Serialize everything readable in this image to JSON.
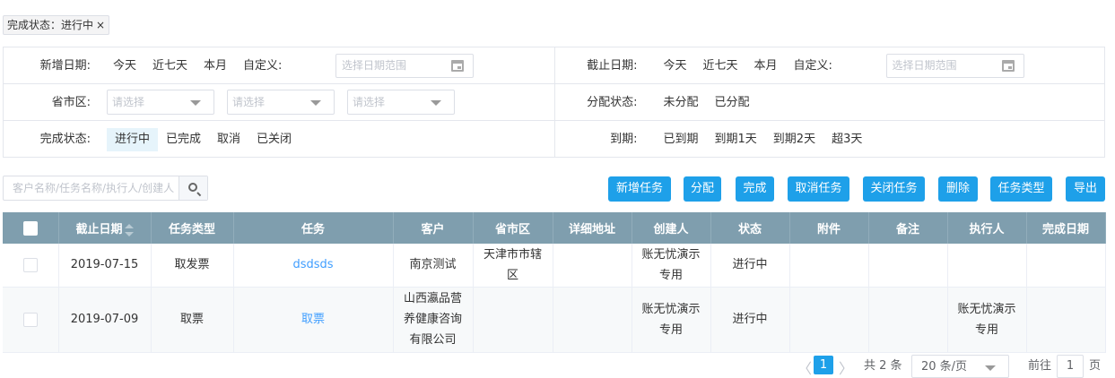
{
  "active_filter": {
    "label": "完成状态：进行中",
    "close": "×"
  },
  "filters": {
    "new_date": {
      "label": "新增日期:",
      "options": [
        "今天",
        "近七天",
        "本月",
        "自定义:"
      ],
      "placeholder": "选择日期范围"
    },
    "due_date": {
      "label": "截止日期:",
      "options": [
        "今天",
        "近七天",
        "本月",
        "自定义:"
      ],
      "placeholder": "选择日期范围"
    },
    "region": {
      "label": "省市区:",
      "selects": [
        "请选择",
        "请选择",
        "请选择"
      ]
    },
    "assign_status": {
      "label": "分配状态:",
      "options": [
        "未分配",
        "已分配"
      ]
    },
    "complete_status": {
      "label": "完成状态:",
      "options": [
        "进行中",
        "已完成",
        "取消",
        "已关闭"
      ],
      "active": "进行中"
    },
    "expire": {
      "label": "到期:",
      "options": [
        "已到期",
        "到期1天",
        "到期2天",
        "超3天"
      ]
    }
  },
  "search": {
    "placeholder": "客户名称/任务名称/执行人/创建人"
  },
  "toolbar": {
    "buttons": [
      "新增任务",
      "分配",
      "完成",
      "取消任务",
      "关闭任务",
      "删除",
      "任务类型",
      "导出"
    ]
  },
  "table": {
    "columns": [
      "截止日期",
      "任务类型",
      "任务",
      "客户",
      "省市区",
      "详细地址",
      "创建人",
      "状态",
      "附件",
      "备注",
      "执行人",
      "完成日期"
    ],
    "rows": [
      {
        "due": "2019-07-15",
        "type": "取发票",
        "task": "dsdsds",
        "customer": "南京测试",
        "region": "天津市市辖区",
        "address": "",
        "creator": "账无忧演示专用",
        "status": "进行中",
        "attachment": "",
        "note": "",
        "executor": "",
        "done": ""
      },
      {
        "due": "2019-07-09",
        "type": "取票",
        "task": "取票",
        "customer": "山西瀛品营养健康咨询有限公司",
        "region": "",
        "address": "",
        "creator": "账无忧演示专用",
        "status": "进行中",
        "attachment": "",
        "note": "",
        "executor": "账无忧演示专用",
        "done": ""
      }
    ]
  },
  "pagination": {
    "prev": "〈",
    "next": "〉",
    "current": "1",
    "total": "共 2 条",
    "page_size": "20 条/页",
    "goto_label": "前往",
    "goto_value": "1",
    "page_unit": "页"
  },
  "colors": {
    "primary": "#1ea0e9",
    "header_bg": "#7f9eae",
    "link": "#409eff",
    "active_option_bg": "#e6f4fb"
  }
}
